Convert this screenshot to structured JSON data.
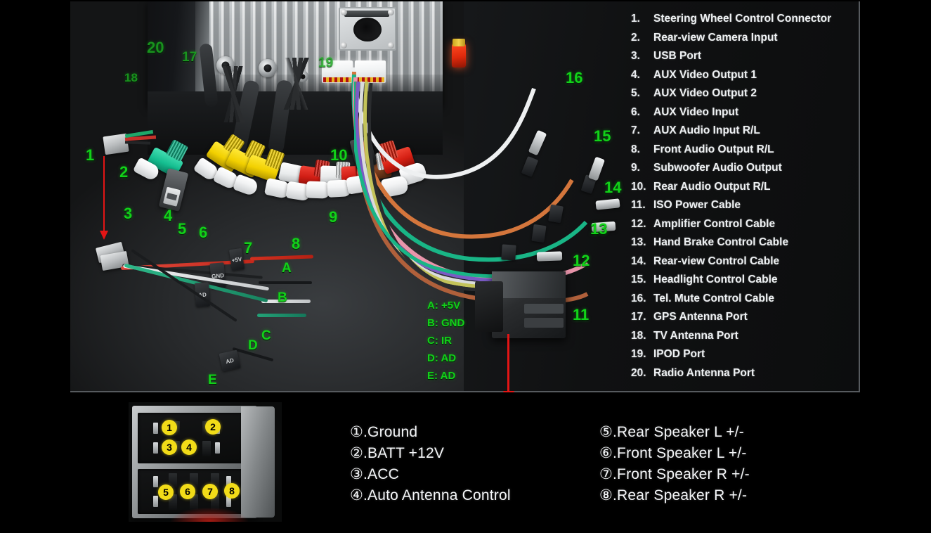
{
  "panel": {
    "spec_list": [
      {
        "num": "1.",
        "label": "Steering Wheel Control Connector"
      },
      {
        "num": "2.",
        "label": "Rear-view Camera Input"
      },
      {
        "num": "3.",
        "label": "USB Port"
      },
      {
        "num": "4.",
        "label": "AUX Video Output 1"
      },
      {
        "num": "5.",
        "label": "AUX Video Output 2"
      },
      {
        "num": "6.",
        "label": "AUX Video Input"
      },
      {
        "num": "7.",
        "label": "AUX Audio Input R/L"
      },
      {
        "num": "8.",
        "label": "Front Audio Output R/L"
      },
      {
        "num": "9.",
        "label": "Subwoofer Audio Output"
      },
      {
        "num": "10.",
        "label": "Rear Audio Output R/L"
      },
      {
        "num": "11.",
        "label": "ISO Power Cable"
      },
      {
        "num": "12.",
        "label": "Amplifier Control Cable"
      },
      {
        "num": "13.",
        "label": "Hand Brake Control Cable"
      },
      {
        "num": "14.",
        "label": "Rear-view Control Cable"
      },
      {
        "num": "15.",
        "label": "Headlight Control Cable"
      },
      {
        "num": "16.",
        "label": "Tel. Mute Control Cable"
      },
      {
        "num": "17.",
        "label": "GPS Antenna Port"
      },
      {
        "num": "18.",
        "label": "TV Antenna Port"
      },
      {
        "num": "19.",
        "label": "IPOD Port"
      },
      {
        "num": "20.",
        "label": "Radio Antenna Port"
      }
    ],
    "callouts": [
      {
        "id": "1",
        "text": "1"
      },
      {
        "id": "2",
        "text": "2"
      },
      {
        "id": "3",
        "text": "3"
      },
      {
        "id": "4",
        "text": "4"
      },
      {
        "id": "5",
        "text": "5"
      },
      {
        "id": "6",
        "text": "6"
      },
      {
        "id": "7",
        "text": "7"
      },
      {
        "id": "8",
        "text": "8"
      },
      {
        "id": "9",
        "text": "9"
      },
      {
        "id": "10",
        "text": "10"
      },
      {
        "id": "11",
        "text": "11"
      },
      {
        "id": "12",
        "text": "12"
      },
      {
        "id": "13",
        "text": "13"
      },
      {
        "id": "14",
        "text": "14"
      },
      {
        "id": "15",
        "text": "15"
      },
      {
        "id": "16",
        "text": "16"
      },
      {
        "id": "17",
        "text": "17"
      },
      {
        "id": "18",
        "text": "18"
      },
      {
        "id": "19",
        "text": "19"
      },
      {
        "id": "20",
        "text": "20"
      },
      {
        "id": "A",
        "text": "A"
      },
      {
        "id": "B",
        "text": "B"
      },
      {
        "id": "C",
        "text": "C"
      },
      {
        "id": "D",
        "text": "D"
      },
      {
        "id": "E",
        "text": "E"
      }
    ],
    "ae_legend": [
      "A: +5V",
      "B: GND",
      "C: IR",
      "D: AD",
      "E: AD"
    ],
    "wire_tags": [
      "+5V",
      "GND",
      "AD",
      "AD"
    ]
  },
  "bottom": {
    "pin_circles": [
      "1",
      "2",
      "3",
      "4",
      "5",
      "6",
      "7",
      "8"
    ],
    "pin_legend_col1": [
      "①.Ground",
      "②.BATT +12V",
      "③.ACC",
      "④.Auto Antenna Control"
    ],
    "pin_legend_col2": [
      "⑤.Rear Speaker L +/-",
      "⑥.Front Speaker L +/-",
      "⑦.Front Speaker R +/-",
      "⑧.Rear Speaker R +/-"
    ]
  },
  "colors": {
    "callout_green": "#12d219",
    "arrow_red": "#e31515",
    "pin_yellow": "#f2dc18",
    "list_text": "#eef1f3",
    "background": "#000000"
  }
}
